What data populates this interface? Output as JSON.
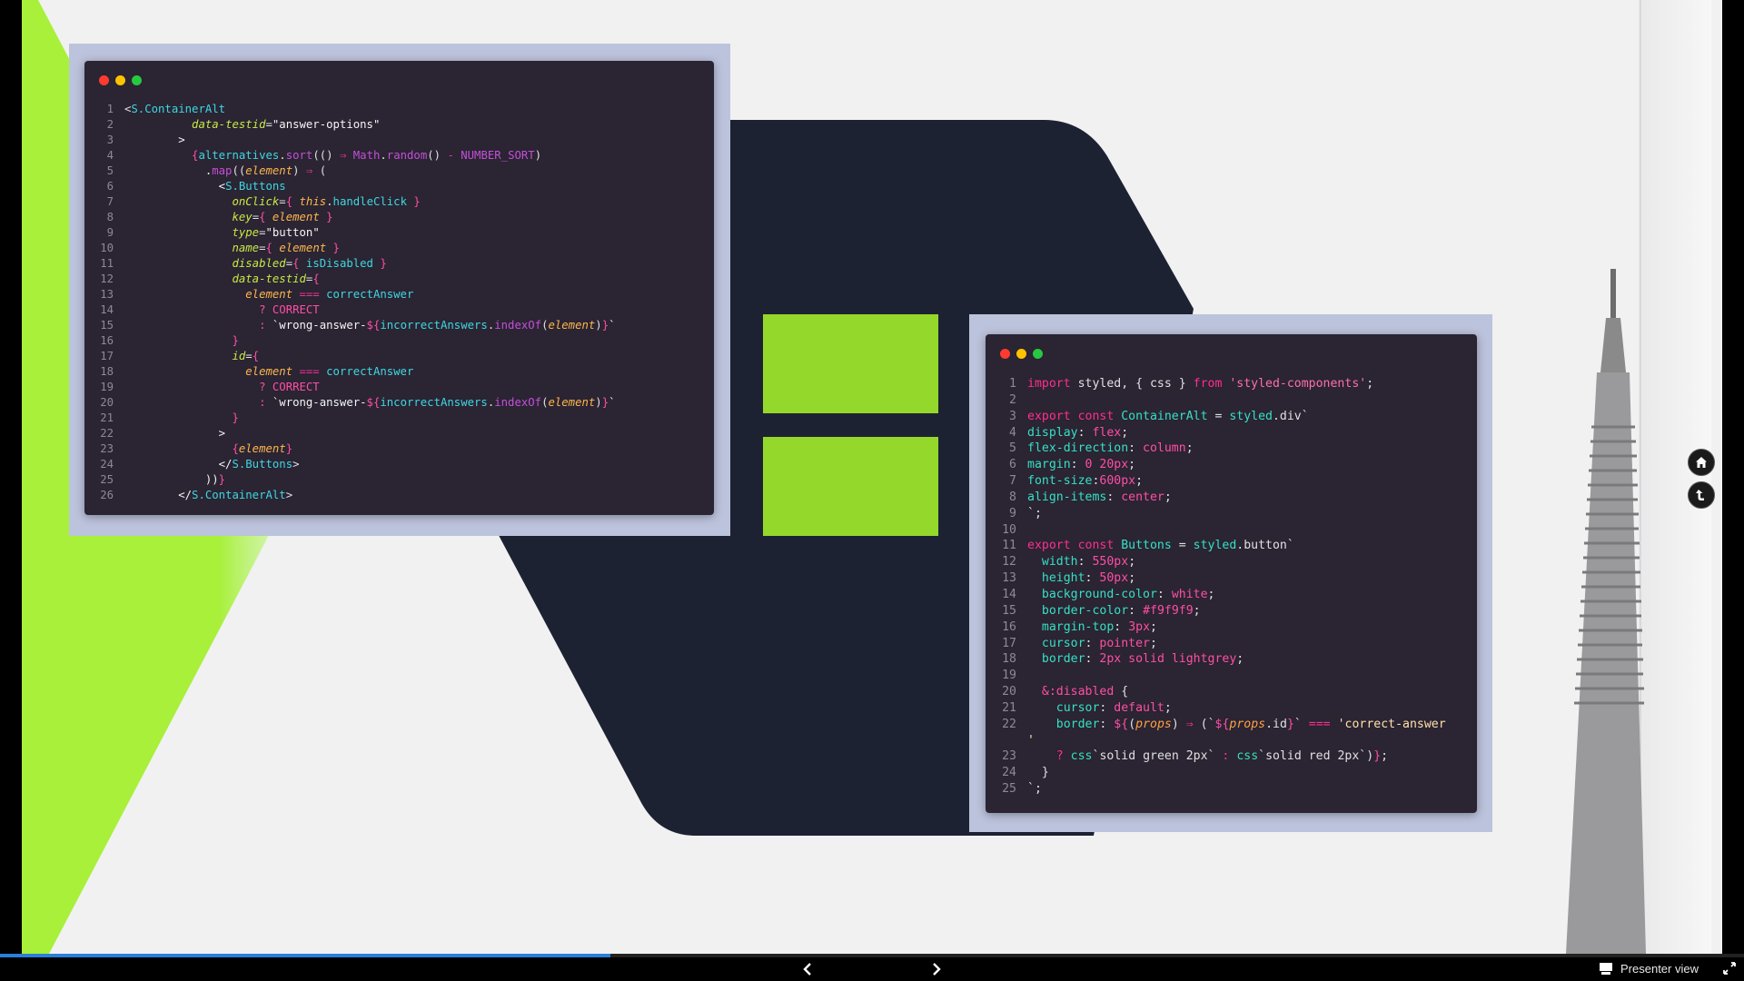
{
  "colors": {
    "slide_bg": "#f1f1f2",
    "lime_accent": "#a8f03a",
    "hexagon_navy": "#1d2233",
    "green_block": "#94d82b",
    "code_bg": "#2a2433",
    "frame": "#bcc3dc",
    "progress": "#2b7fd9",
    "dot_red": "#ff3b30",
    "dot_yellow": "#ffc300",
    "dot_green": "#27c93f"
  },
  "syntax_colors": {
    "p": "#e0e0e0",
    "t": "#3fd7e0",
    "a": "#c9e843",
    "s": "#f5f5f5",
    "k": "#e8338f",
    "m": "#c54fd8",
    "v": "#ffb74d",
    "c": "#ff4fa3",
    "y": "#ff4fa3",
    "n": "#ff4fa3",
    "cs": "#36e0b8",
    "st": "#ff6fa8",
    "kw": "#ff2f8e",
    "pr": "#36e0c4",
    "pv": "#ff4fa3",
    "ps": "#ffe1a8",
    "pp": "#ff9f43"
  },
  "code_window_1": {
    "lines": [
      {
        "n": "1",
        "t": [
          [
            "p",
            "<"
          ],
          [
            "t",
            "S.ContainerAlt"
          ]
        ]
      },
      {
        "n": "2",
        "t": [
          [
            "s",
            "          "
          ],
          [
            "a",
            "data-testid"
          ],
          [
            "p",
            "="
          ],
          [
            "s",
            "\"answer-options\""
          ]
        ]
      },
      {
        "n": "3",
        "t": [
          [
            "s",
            "        >"
          ]
        ]
      },
      {
        "n": "4",
        "t": [
          [
            "s",
            "          "
          ],
          [
            "c",
            "{"
          ],
          [
            "t",
            "alternatives"
          ],
          [
            "p",
            "."
          ],
          [
            "m",
            "sort"
          ],
          [
            "p",
            "(() "
          ],
          [
            "k",
            "⇒"
          ],
          [
            "p",
            " "
          ],
          [
            "m",
            "Math"
          ],
          [
            "p",
            "."
          ],
          [
            "m",
            "random"
          ],
          [
            "p",
            "() "
          ],
          [
            "k",
            "-"
          ],
          [
            "p",
            " "
          ],
          [
            "m",
            "NUMBER_SORT"
          ],
          [
            "p",
            ")"
          ]
        ]
      },
      {
        "n": "5",
        "t": [
          [
            "s",
            "            ."
          ],
          [
            "m",
            "map"
          ],
          [
            "p",
            "(("
          ],
          [
            "v",
            "element"
          ],
          [
            "p",
            ") "
          ],
          [
            "k",
            "⇒"
          ],
          [
            "p",
            " ("
          ]
        ]
      },
      {
        "n": "6",
        "t": [
          [
            "s",
            "              <"
          ],
          [
            "t",
            "S.Buttons"
          ]
        ]
      },
      {
        "n": "7",
        "t": [
          [
            "s",
            "                "
          ],
          [
            "a",
            "onClick"
          ],
          [
            "p",
            "="
          ],
          [
            "c",
            "{ "
          ],
          [
            "v",
            "this"
          ],
          [
            "p",
            "."
          ],
          [
            "t",
            "handleClick"
          ],
          [
            "c",
            " }"
          ]
        ]
      },
      {
        "n": "8",
        "t": [
          [
            "s",
            "                "
          ],
          [
            "a",
            "key"
          ],
          [
            "p",
            "="
          ],
          [
            "c",
            "{ "
          ],
          [
            "v",
            "element"
          ],
          [
            "c",
            " }"
          ]
        ]
      },
      {
        "n": "9",
        "t": [
          [
            "s",
            "                "
          ],
          [
            "a",
            "type"
          ],
          [
            "p",
            "="
          ],
          [
            "s",
            "\"button\""
          ]
        ]
      },
      {
        "n": "10",
        "t": [
          [
            "s",
            "                "
          ],
          [
            "a",
            "name"
          ],
          [
            "p",
            "="
          ],
          [
            "c",
            "{ "
          ],
          [
            "v",
            "element"
          ],
          [
            "c",
            " }"
          ]
        ]
      },
      {
        "n": "11",
        "t": [
          [
            "s",
            "                "
          ],
          [
            "a",
            "disabled"
          ],
          [
            "p",
            "="
          ],
          [
            "c",
            "{ "
          ],
          [
            "t",
            "isDisabled"
          ],
          [
            "c",
            " }"
          ]
        ]
      },
      {
        "n": "12",
        "t": [
          [
            "s",
            "                "
          ],
          [
            "a",
            "data-testid"
          ],
          [
            "p",
            "="
          ],
          [
            "c",
            "{"
          ]
        ]
      },
      {
        "n": "13",
        "t": [
          [
            "s",
            "                  "
          ],
          [
            "v",
            "element"
          ],
          [
            "p",
            " "
          ],
          [
            "k",
            "==="
          ],
          [
            "p",
            " "
          ],
          [
            "t",
            "correctAnswer"
          ]
        ]
      },
      {
        "n": "14",
        "t": [
          [
            "s",
            "                    "
          ],
          [
            "y",
            "?"
          ],
          [
            "p",
            " "
          ],
          [
            "n",
            "CORRECT"
          ]
        ]
      },
      {
        "n": "15",
        "t": [
          [
            "s",
            "                    "
          ],
          [
            "y",
            ":"
          ],
          [
            "p",
            " "
          ],
          [
            "s",
            "`wrong-answer-"
          ],
          [
            "c",
            "${"
          ],
          [
            "t",
            "incorrectAnswers"
          ],
          [
            "p",
            "."
          ],
          [
            "m",
            "indexOf"
          ],
          [
            "p",
            "("
          ],
          [
            "v",
            "element"
          ],
          [
            "p",
            ")"
          ],
          [
            "c",
            "}"
          ],
          [
            "s",
            "`"
          ]
        ]
      },
      {
        "n": "16",
        "t": [
          [
            "s",
            "                "
          ],
          [
            "c",
            "}"
          ]
        ]
      },
      {
        "n": "17",
        "t": [
          [
            "s",
            "                "
          ],
          [
            "a",
            "id"
          ],
          [
            "p",
            "="
          ],
          [
            "c",
            "{"
          ]
        ]
      },
      {
        "n": "18",
        "t": [
          [
            "s",
            "                  "
          ],
          [
            "v",
            "element"
          ],
          [
            "p",
            " "
          ],
          [
            "k",
            "==="
          ],
          [
            "p",
            " "
          ],
          [
            "t",
            "correctAnswer"
          ]
        ]
      },
      {
        "n": "19",
        "t": [
          [
            "s",
            "                    "
          ],
          [
            "y",
            "?"
          ],
          [
            "p",
            " "
          ],
          [
            "n",
            "CORRECT"
          ]
        ]
      },
      {
        "n": "20",
        "t": [
          [
            "s",
            "                    "
          ],
          [
            "y",
            ":"
          ],
          [
            "p",
            " "
          ],
          [
            "s",
            "`wrong-answer-"
          ],
          [
            "c",
            "${"
          ],
          [
            "t",
            "incorrectAnswers"
          ],
          [
            "p",
            "."
          ],
          [
            "m",
            "indexOf"
          ],
          [
            "p",
            "("
          ],
          [
            "v",
            "element"
          ],
          [
            "p",
            ")"
          ],
          [
            "c",
            "}"
          ],
          [
            "s",
            "`"
          ]
        ]
      },
      {
        "n": "21",
        "t": [
          [
            "s",
            "                "
          ],
          [
            "c",
            "}"
          ]
        ]
      },
      {
        "n": "22",
        "t": [
          [
            "s",
            "              >"
          ]
        ]
      },
      {
        "n": "23",
        "t": [
          [
            "s",
            "                "
          ],
          [
            "c",
            "{"
          ],
          [
            "v",
            "element"
          ],
          [
            "c",
            "}"
          ]
        ]
      },
      {
        "n": "24",
        "t": [
          [
            "s",
            "              </"
          ],
          [
            "t",
            "S.Buttons"
          ],
          [
            "p",
            ">"
          ]
        ]
      },
      {
        "n": "25",
        "t": [
          [
            "s",
            "            ))"
          ],
          [
            "c",
            "}"
          ]
        ]
      },
      {
        "n": "26",
        "t": [
          [
            "s",
            "        </"
          ],
          [
            "t",
            "S.ContainerAlt"
          ],
          [
            "p",
            ">"
          ]
        ]
      }
    ]
  },
  "code_window_2": {
    "lines": [
      {
        "n": "1",
        "t": [
          [
            "kw",
            "import"
          ],
          [
            "p",
            " styled, { css } "
          ],
          [
            "kw",
            "from"
          ],
          [
            "p",
            " "
          ],
          [
            "st",
            "'styled-components'"
          ],
          [
            "p",
            ";"
          ]
        ]
      },
      {
        "n": "2",
        "t": []
      },
      {
        "n": "3",
        "t": [
          [
            "kw",
            "export const"
          ],
          [
            "p",
            " "
          ],
          [
            "pr",
            "ContainerAlt"
          ],
          [
            "p",
            " = "
          ],
          [
            "pr",
            "styled"
          ],
          [
            "p",
            ".div`"
          ]
        ]
      },
      {
        "n": "4",
        "t": [
          [
            "pr",
            "display"
          ],
          [
            "p",
            ": "
          ],
          [
            "pv",
            "flex"
          ],
          [
            "p",
            ";"
          ]
        ]
      },
      {
        "n": "5",
        "t": [
          [
            "pr",
            "flex-direction"
          ],
          [
            "p",
            ": "
          ],
          [
            "pv",
            "column"
          ],
          [
            "p",
            ";"
          ]
        ]
      },
      {
        "n": "6",
        "t": [
          [
            "pr",
            "margin"
          ],
          [
            "p",
            ": "
          ],
          [
            "pv",
            "0 20px"
          ],
          [
            "p",
            ";"
          ]
        ]
      },
      {
        "n": "7",
        "t": [
          [
            "pr",
            "font-size"
          ],
          [
            "p",
            ":"
          ],
          [
            "pv",
            "600px"
          ],
          [
            "p",
            ";"
          ]
        ]
      },
      {
        "n": "8",
        "t": [
          [
            "pr",
            "align-items"
          ],
          [
            "p",
            ": "
          ],
          [
            "pv",
            "center"
          ],
          [
            "p",
            ";"
          ]
        ]
      },
      {
        "n": "9",
        "t": [
          [
            "p",
            "`;"
          ]
        ]
      },
      {
        "n": "10",
        "t": []
      },
      {
        "n": "11",
        "t": [
          [
            "kw",
            "export const"
          ],
          [
            "p",
            " "
          ],
          [
            "pr",
            "Buttons"
          ],
          [
            "p",
            " = "
          ],
          [
            "pr",
            "styled"
          ],
          [
            "p",
            ".button`"
          ]
        ]
      },
      {
        "n": "12",
        "t": [
          [
            "p",
            "  "
          ],
          [
            "pr",
            "width"
          ],
          [
            "p",
            ": "
          ],
          [
            "pv",
            "550px"
          ],
          [
            "p",
            ";"
          ]
        ]
      },
      {
        "n": "13",
        "t": [
          [
            "p",
            "  "
          ],
          [
            "pr",
            "height"
          ],
          [
            "p",
            ": "
          ],
          [
            "pv",
            "50px"
          ],
          [
            "p",
            ";"
          ]
        ]
      },
      {
        "n": "14",
        "t": [
          [
            "p",
            "  "
          ],
          [
            "pr",
            "background-color"
          ],
          [
            "p",
            ": "
          ],
          [
            "pv",
            "white"
          ],
          [
            "p",
            ";"
          ]
        ]
      },
      {
        "n": "15",
        "t": [
          [
            "p",
            "  "
          ],
          [
            "pr",
            "border-color"
          ],
          [
            "p",
            ": "
          ],
          [
            "pv",
            "#f9f9f9"
          ],
          [
            "p",
            ";"
          ]
        ]
      },
      {
        "n": "16",
        "t": [
          [
            "p",
            "  "
          ],
          [
            "pr",
            "margin-top"
          ],
          [
            "p",
            ": "
          ],
          [
            "pv",
            "3px"
          ],
          [
            "p",
            ";"
          ]
        ]
      },
      {
        "n": "17",
        "t": [
          [
            "p",
            "  "
          ],
          [
            "pr",
            "cursor"
          ],
          [
            "p",
            ": "
          ],
          [
            "pv",
            "pointer"
          ],
          [
            "p",
            ";"
          ]
        ]
      },
      {
        "n": "18",
        "t": [
          [
            "p",
            "  "
          ],
          [
            "pr",
            "border"
          ],
          [
            "p",
            ": "
          ],
          [
            "pv",
            "2px solid lightgrey"
          ],
          [
            "p",
            ";"
          ]
        ]
      },
      {
        "n": "19",
        "t": []
      },
      {
        "n": "20",
        "t": [
          [
            "p",
            "  "
          ],
          [
            "pv",
            "&:disabled"
          ],
          [
            "p",
            " {"
          ]
        ]
      },
      {
        "n": "21",
        "t": [
          [
            "p",
            "    "
          ],
          [
            "pr",
            "cursor"
          ],
          [
            "p",
            ": "
          ],
          [
            "pv",
            "default"
          ],
          [
            "p",
            ";"
          ]
        ]
      },
      {
        "n": "22",
        "t": [
          [
            "p",
            "    "
          ],
          [
            "pr",
            "border"
          ],
          [
            "p",
            ": "
          ],
          [
            "pv",
            "${"
          ],
          [
            "p",
            "("
          ],
          [
            "pp",
            "props"
          ],
          [
            "p",
            ") "
          ],
          [
            "kw",
            "⇒"
          ],
          [
            "p",
            " (`"
          ],
          [
            "pv",
            "${"
          ],
          [
            "pp",
            "props"
          ],
          [
            "p",
            ".id"
          ],
          [
            "pv",
            "}"
          ],
          [
            "p",
            "` "
          ],
          [
            "kw",
            "==="
          ],
          [
            "p",
            " "
          ],
          [
            "ps",
            "'correct-answer"
          ]
        ]
      },
      {
        "n": "",
        "t": [
          [
            "ps",
            "'"
          ]
        ]
      },
      {
        "n": "23",
        "t": [
          [
            "p",
            "    "
          ],
          [
            "kw",
            "?"
          ],
          [
            "p",
            " "
          ],
          [
            "cs",
            "css"
          ],
          [
            "p",
            "`solid green 2px` "
          ],
          [
            "kw",
            ":"
          ],
          [
            "p",
            " "
          ],
          [
            "cs",
            "css"
          ],
          [
            "p",
            "`solid red 2px`)"
          ],
          [
            "pv",
            "}"
          ],
          [
            "p",
            ";"
          ]
        ]
      },
      {
        "n": "24",
        "t": [
          [
            "p",
            "  }"
          ]
        ]
      },
      {
        "n": "25",
        "t": [
          [
            "p",
            "`;"
          ]
        ]
      }
    ]
  },
  "side_nav": {
    "home_icon": "home-icon",
    "back_icon": "return-icon"
  },
  "bottom_bar": {
    "progress": 0.35,
    "prev_icon": "chevron-left-icon",
    "next_icon": "chevron-right-icon",
    "presenter_label": "Presenter view",
    "presenter_icon": "presenter-icon",
    "fullscreen_icon": "fullscreen-icon"
  }
}
